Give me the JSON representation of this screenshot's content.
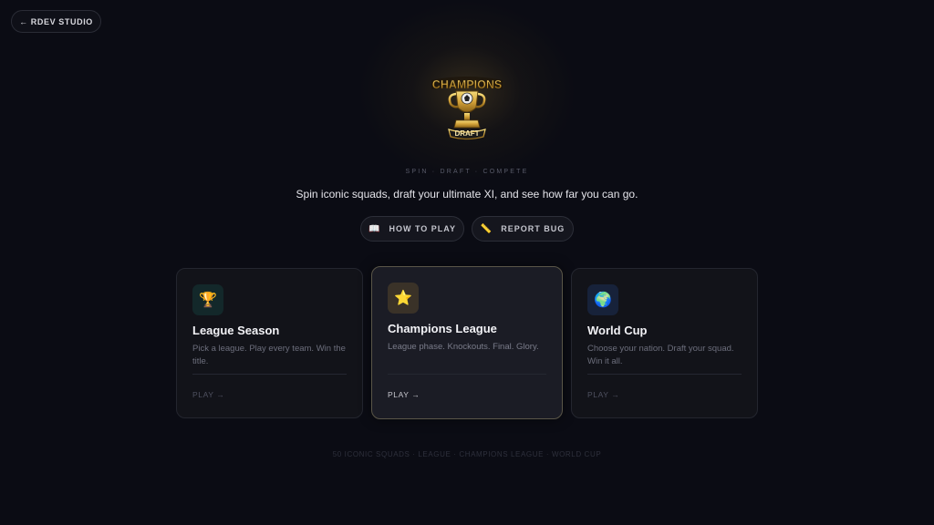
{
  "nav": {
    "back_label": "← RDEV STUDIO"
  },
  "logo": {
    "line1": "CHAMPIONS",
    "line2": "DRAFT"
  },
  "hero": {
    "tagline": "SPIN · DRAFT · COMPETE",
    "subtitle": "Spin iconic squads, draft your ultimate XI, and see how far you can go."
  },
  "actions": [
    {
      "icon": "📖",
      "label": "HOW TO PLAY"
    },
    {
      "icon": "📏",
      "label": "REPORT BUG"
    }
  ],
  "modes": [
    {
      "icon": "🏆",
      "icon_name": "trophy-icon",
      "title": "League Season",
      "description": "Pick a league. Play every team. Win the title.",
      "play": "PLAY →",
      "icon_bg": "#13282a"
    },
    {
      "icon": "⭐",
      "icon_name": "star-icon",
      "title": "Champions League",
      "description": "League phase. Knockouts. Final. Glory.",
      "play": "PLAY →",
      "icon_bg": "#3a3228"
    },
    {
      "icon": "🌍",
      "icon_name": "globe-icon",
      "title": "World Cup",
      "description": "Choose your nation. Draft your squad. Win it all.",
      "play": "PLAY →",
      "icon_bg": "#17223a"
    }
  ],
  "footer": {
    "text": "50 ICONIC SQUADS · LEAGUE · CHAMPIONS LEAGUE · WORLD CUP"
  },
  "colors": {
    "background": "#0b0c14",
    "accent_gold": "#d4a93a",
    "card_border_featured": "#5a5648"
  }
}
